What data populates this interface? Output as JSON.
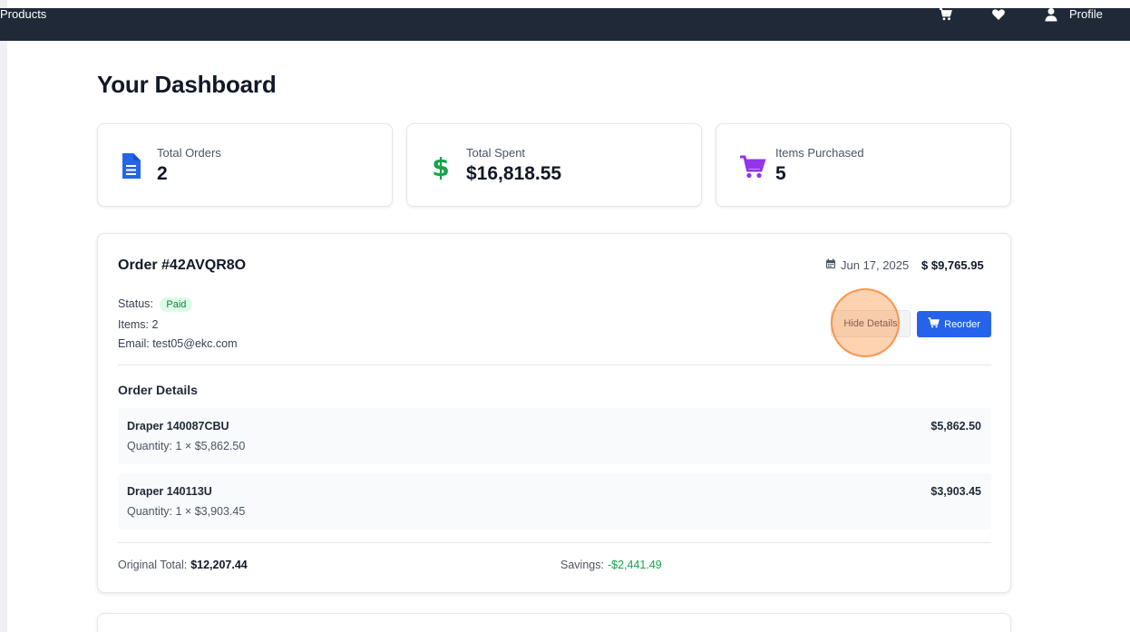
{
  "navbar": {
    "products_label": "Products",
    "profile_label": "Profile",
    "icons": [
      "cart-icon",
      "heart-icon",
      "user-icon"
    ]
  },
  "page": {
    "title": "Your Dashboard"
  },
  "stats": [
    {
      "label": "Total Orders",
      "value": "2",
      "icon": "document-icon",
      "color": "#2563eb"
    },
    {
      "label": "Total Spent",
      "value": "$16,818.55",
      "icon": "dollar-icon",
      "color": "#16a34a"
    },
    {
      "label": "Items Purchased",
      "value": "5",
      "icon": "cart-icon",
      "color": "#9333ea"
    }
  ],
  "order": {
    "number": "Order #42AVQR8O",
    "date": "Jun 17, 2025",
    "total": "$ $9,765.95",
    "status_label": "Status:",
    "status": "Paid",
    "items": "Items: 2",
    "email": "Email: test05@ekc.com",
    "hide_details_label": "Hide Details",
    "reorder_label": "Reorder",
    "details_title": "Order Details",
    "line_items": [
      {
        "name": "Draper 140087CBU",
        "quantity": "Quantity: 1 × $5,862.50",
        "price": "$5,862.50"
      },
      {
        "name": "Draper 140113U",
        "quantity": "Quantity: 1 × $3,903.45",
        "price": "$3,903.45"
      }
    ],
    "original_total_label": "Original Total:",
    "original_total": "$12,207.44",
    "savings_label": "Savings:",
    "savings": "-$2,441.49"
  },
  "colors": {
    "navbar_bg": "#1f2937",
    "primary": "#2563eb",
    "success": "#16a34a",
    "purple": "#9333ea",
    "click_highlight": "#fb923c"
  }
}
